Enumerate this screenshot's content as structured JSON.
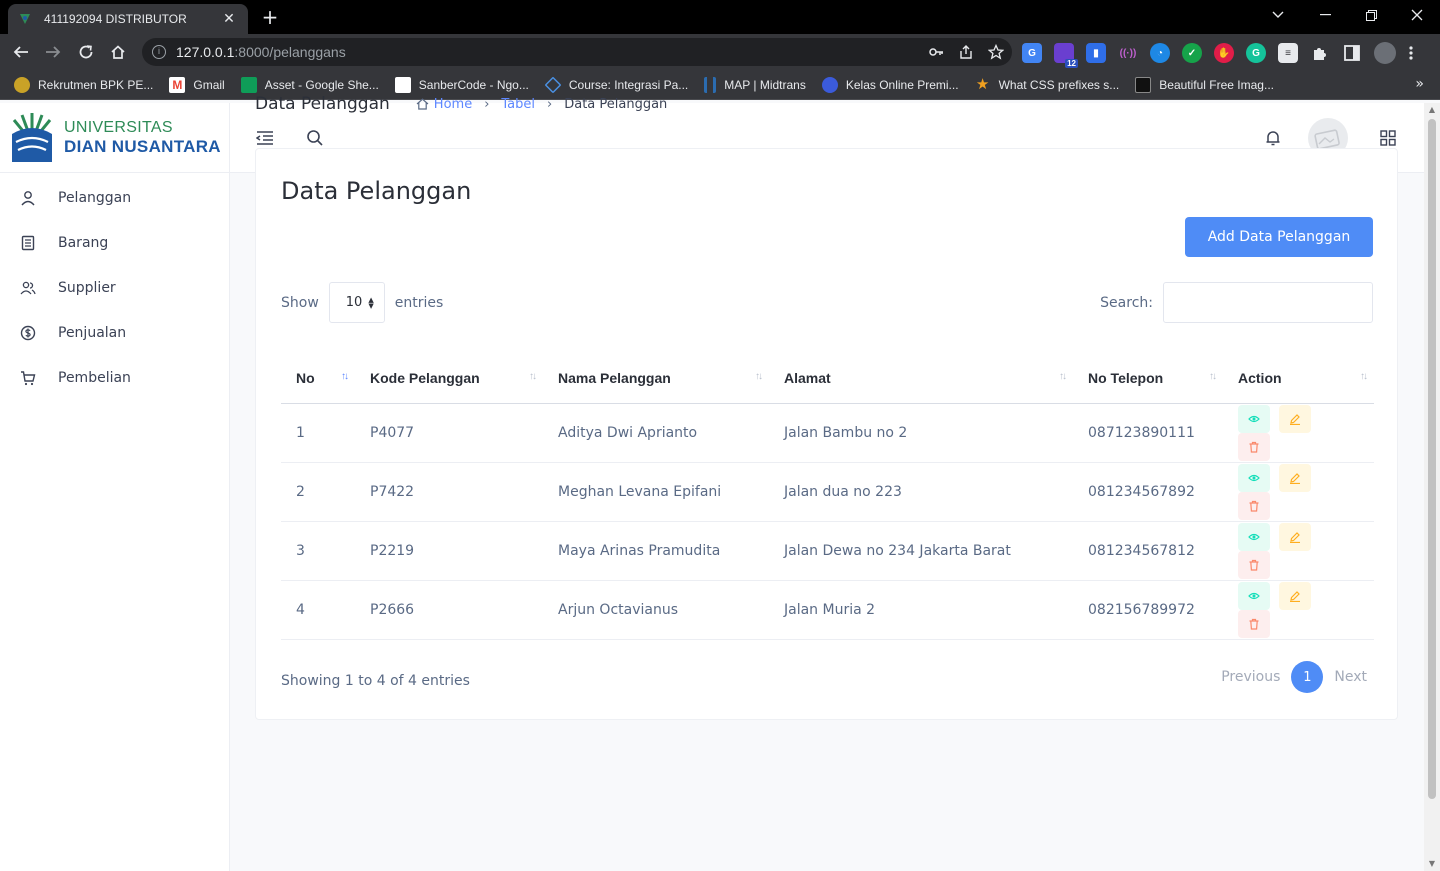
{
  "browser": {
    "tab_title": "411192094 DISTRIBUTOR",
    "url_host": "127.0.0.1",
    "url_path": ":8000/pelanggans",
    "extension_badge": "12",
    "bookmarks": [
      {
        "label": "Rekrutmen BPK PE...",
        "color": "#c9a227"
      },
      {
        "label": "Gmail",
        "color": "#ea4335"
      },
      {
        "label": "Asset - Google She...",
        "color": "#0f9d58"
      },
      {
        "label": "SanberCode - Ngo...",
        "color": "#ffffff"
      },
      {
        "label": "Course: Integrasi Pa...",
        "color": "#4a90e2"
      },
      {
        "label": "MAP | Midtrans",
        "color": "#2b6cb0"
      },
      {
        "label": "Kelas Online Premi...",
        "color": "#3b5bdb"
      },
      {
        "label": "What CSS prefixes s...",
        "color": "#f0a020"
      },
      {
        "label": "Beautiful Free Imag...",
        "color": "#111111"
      }
    ]
  },
  "brand": {
    "line1": "UNIVERSITAS",
    "line2": "DIAN NUSANTARA"
  },
  "sidebar": {
    "items": [
      {
        "label": "Pelanggan",
        "icon": "user-icon"
      },
      {
        "label": "Barang",
        "icon": "list-icon"
      },
      {
        "label": "Supplier",
        "icon": "users-icon"
      },
      {
        "label": "Penjualan",
        "icon": "dollar-icon"
      },
      {
        "label": "Pembelian",
        "icon": "cart-icon"
      }
    ]
  },
  "page": {
    "title": "Data Pelanggan",
    "breadcrumb": {
      "home": "Home",
      "tabel": "Tabel",
      "current": "Data Pelanggan"
    }
  },
  "card": {
    "title": "Data Pelanggan",
    "add_button": "Add Data Pelanggan",
    "show_label": "Show",
    "entries_value": "10",
    "entries_label": "entries",
    "search_label": "Search:",
    "search_value": "",
    "columns": [
      "No",
      "Kode Pelanggan",
      "Nama Pelanggan",
      "Alamat",
      "No Telepon",
      "Action"
    ],
    "rows": [
      {
        "no": "1",
        "kode": "P4077",
        "nama": "Aditya Dwi Aprianto",
        "alamat": "Jalan Bambu no 2",
        "telepon": "087123890111"
      },
      {
        "no": "2",
        "kode": "P7422",
        "nama": "Meghan Levana Epifani",
        "alamat": "Jalan dua no 223",
        "telepon": "081234567892"
      },
      {
        "no": "3",
        "kode": "P2219",
        "nama": "Maya Arinas Pramudita",
        "alamat": "Jalan Dewa no 234 Jakarta Barat",
        "telepon": "081234567812"
      },
      {
        "no": "4",
        "kode": "P2666",
        "nama": "Arjun Octavianus",
        "alamat": "Jalan Muria 2",
        "telepon": "082156789972"
      }
    ],
    "info": "Showing 1 to 4 of 4 entries",
    "pagination": {
      "previous": "Previous",
      "current": "1",
      "next": "Next"
    }
  },
  "colors": {
    "primary": "#4f8cf6",
    "view": "#13deb9",
    "edit": "#ffae1f",
    "delete": "#fa896b"
  }
}
